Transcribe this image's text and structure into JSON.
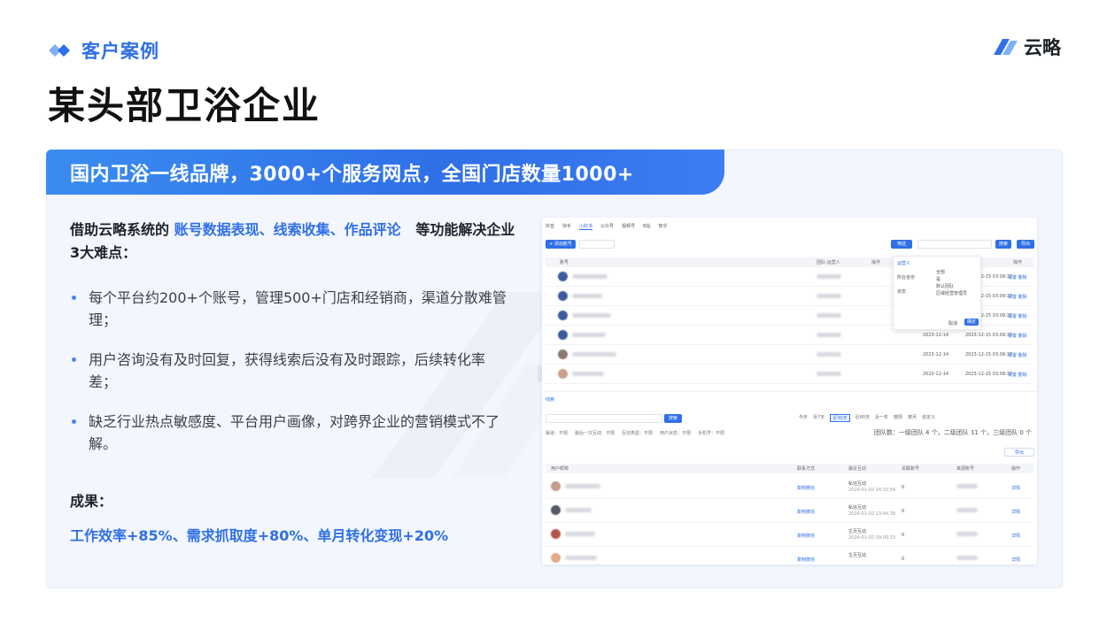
{
  "header": {
    "kicker": "客户案例",
    "title": "某头部卫浴企业",
    "brand": "云略"
  },
  "banner": {
    "text": "国内卫浴一线品牌，3000+个服务网点，全国门店数量1000+"
  },
  "watermark": "云略",
  "intro": {
    "prefix": "借助云略系统的",
    "highlight": "账号数据表现、线索收集、作品评论",
    "suffix": "等功能解决企业3大难点："
  },
  "pain_points": [
    "每个平台约200+个账号，管理500+门店和经销商，渠道分散难管理；",
    "用户咨询没有及时回复，获得线索后没有及时跟踪，后续转化率差；",
    "缺乏行业热点敏感度、平台用户画像，对跨界企业的营销模式不了解。"
  ],
  "result": {
    "label": "成果：",
    "value": "工作效率+85%、需求抓取度+80%、单月转化变现+20%"
  },
  "screenshot": {
    "tabs": [
      "抖音",
      "快手",
      "小红书",
      "公众号",
      "视频号",
      "B站",
      "知乎"
    ],
    "add_button": "+ 添加账号",
    "export_button": "导出",
    "search_button": "搜索",
    "filter_button": "筛选",
    "headers_top": [
      "账号",
      "团队-运营人",
      "操作",
      "操作"
    ],
    "popup_options": [
      "运营人",
      "所在省份",
      "状态",
      "全部",
      "是",
      "默认团队",
      "区域经营管理员"
    ],
    "confirm": "确定",
    "cancel": "取消",
    "rows_top": [
      {
        "date": "2023-12-14",
        "time": "2023-12-15 03:09:30",
        "action": "设置  删除"
      },
      {
        "date": "2023-12-14",
        "time": "2023-12-15 03:09:30",
        "action": "设置  删除"
      },
      {
        "date": "2023-12-14",
        "time": "2023-12-15 03:09:30",
        "action": "设置  删除"
      },
      {
        "date": "2023-12-14",
        "time": "2023-12-15 03:09:30",
        "action": "设置  删除"
      },
      {
        "date": "2023-12-14",
        "time": "2023-12-15 03:09:30",
        "action": "设置  删除"
      },
      {
        "date": "2023-12-14",
        "time": "2023-12-15 03:09:30",
        "action": "设置  删除"
      }
    ],
    "section2_title": "线索",
    "chips": [
      "今天",
      "近7天",
      "近30天",
      "近90天",
      "近一年",
      "按周",
      "按月",
      "自定义"
    ],
    "team_summary": "团队数：一级团队 4 个，二级团队 11 个，三级团队 0 个",
    "filters": [
      "渠道：不限",
      "最后一次互动：不限",
      "互动类型：不限",
      "用户状态：不限",
      "手机号：不限"
    ],
    "headers_bottom": [
      "用户昵称",
      "联系方式",
      "最近互动",
      "关联账号",
      "来源账号",
      "操作"
    ],
    "rows_bottom": [
      {
        "contact": "复制微信",
        "interaction": "私信互动",
        "time": "2024-01-02 14:33:54",
        "count": "0",
        "action": "详情"
      },
      {
        "contact": "复制微信",
        "interaction": "私信互动",
        "time": "2024-01-02 13:44:39",
        "count": "0",
        "action": "详情"
      },
      {
        "contact": "复制微信",
        "interaction": "主页互动",
        "time": "2024-01-02 09:00:23",
        "count": "0",
        "action": "详情"
      },
      {
        "contact": "复制微信",
        "interaction": "主页互动",
        "time": "",
        "count": "0",
        "action": "详情"
      }
    ]
  },
  "colors": {
    "accent": "#2f6fe8",
    "card_bg": "#f3f7fd",
    "title": "#111111"
  }
}
